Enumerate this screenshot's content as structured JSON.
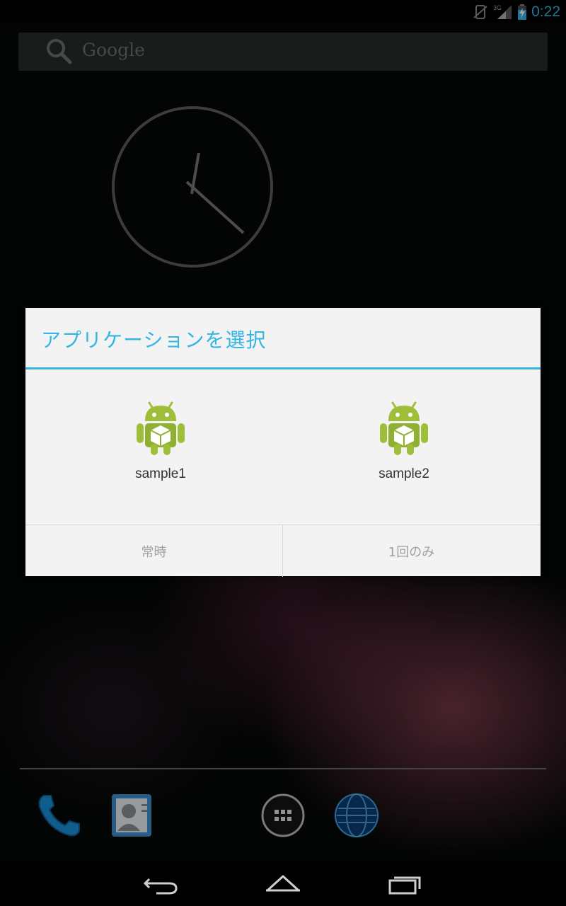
{
  "status_bar": {
    "network": "3G",
    "time": "0:22"
  },
  "search": {
    "placeholder": "Google"
  },
  "dialog": {
    "title": "アプリケーションを選択",
    "apps": [
      {
        "label": "sample1"
      },
      {
        "label": "sample2"
      }
    ],
    "buttons": {
      "always": "常時",
      "just_once": "1回のみ"
    }
  },
  "dock": {
    "icons": [
      "phone-icon",
      "contacts-icon",
      "app-drawer-icon",
      "browser-icon"
    ]
  },
  "nav": {
    "icons": [
      "back-icon",
      "home-icon",
      "recents-icon"
    ]
  },
  "colors": {
    "accent": "#33b5e5",
    "dialog_bg": "#f3f3f3",
    "android_green": "#9fbf3b"
  }
}
